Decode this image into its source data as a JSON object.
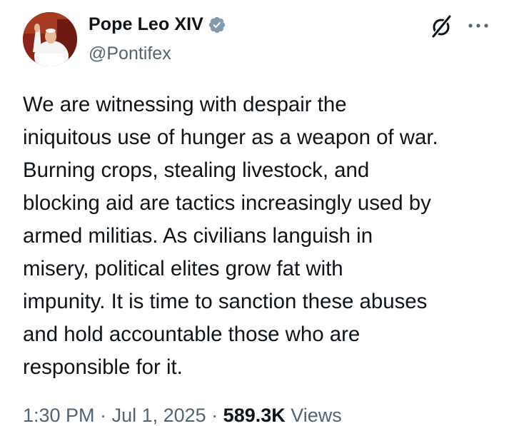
{
  "author": {
    "display_name": "Pope Leo XIV",
    "handle": "@Pontifex",
    "verified_icon": "verified-badge-icon",
    "verified_color": "#829aab"
  },
  "actions": {
    "grok_icon": "grok-icon",
    "more_icon": "more-options-icon"
  },
  "tweet": {
    "lines": [
      "We are witnessing with despair the",
      "iniquitous use of hunger as a weapon of war.",
      "Burning crops, stealing livestock, and",
      "blocking aid are tactics increasingly used by",
      "armed militias. As civilians languish in",
      "misery, political elites grow fat with",
      "impunity. It is time to sanction these abuses",
      "and hold accountable those who are",
      "responsible for it."
    ]
  },
  "meta": {
    "time": "1:30 PM",
    "separator": " · ",
    "date": "Jul 1, 2025",
    "views_count": "589.3K",
    "views_label": "Views"
  },
  "colors": {
    "text": "#0f1419",
    "secondary": "#536471"
  }
}
